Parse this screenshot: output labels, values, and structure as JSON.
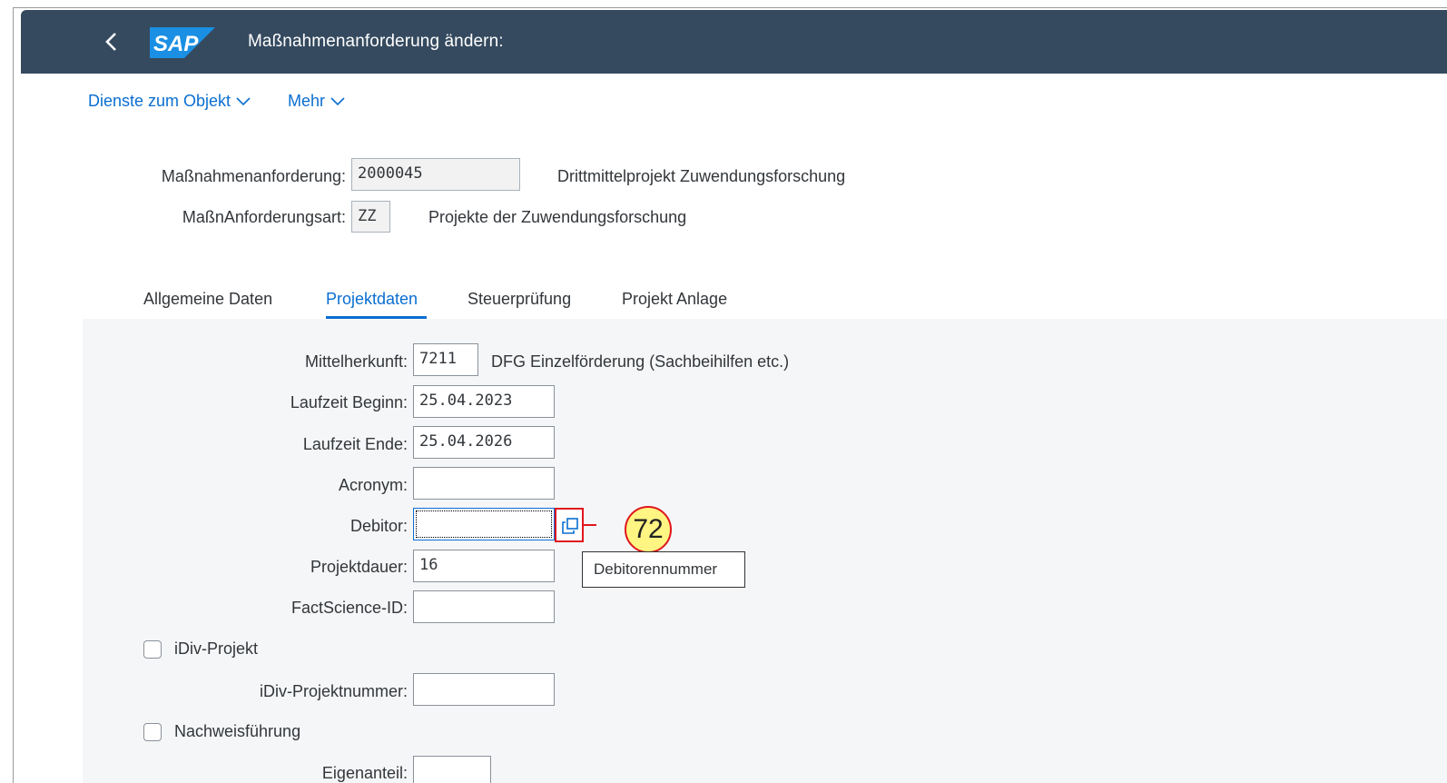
{
  "header": {
    "back_label": "<",
    "logo_text": "SAP",
    "title": "Maßnahmenanforderung ändern:"
  },
  "toolbar": {
    "services_label": "Dienste zum Objekt",
    "more_label": "Mehr"
  },
  "header_fields": {
    "request_label": "Maßnahmenanforderung:",
    "request_value": "2000045",
    "request_desc": "Drittmittelprojekt Zuwendungsforschung",
    "type_label": "MaßnAnforderungsart:",
    "type_value": "ZZ",
    "type_desc": "Projekte der Zuwendungsforschung"
  },
  "tabs": [
    {
      "label": "Allgemeine Daten",
      "active": false
    },
    {
      "label": "Projektdaten",
      "active": true
    },
    {
      "label": "Steuerprüfung",
      "active": false
    },
    {
      "label": "Projekt Anlage",
      "active": false
    }
  ],
  "form": {
    "fund_source_label": "Mittelherkunft:",
    "fund_source_value": "7211",
    "fund_source_desc": "DFG Einzelförderung (Sachbeihilfen etc.)",
    "start_label": "Laufzeit Beginn:",
    "start_value": "25.04.2023",
    "end_label": "Laufzeit Ende:",
    "end_value": "25.04.2026",
    "acronym_label": "Acronym:",
    "acronym_value": "",
    "debitor_label": "Debitor:",
    "debitor_value": "",
    "duration_label": "Projektdauer:",
    "duration_value": "16",
    "factscience_label": "FactScience-ID:",
    "factscience_value": "",
    "idiv_checkbox_label": "iDiv-Projekt",
    "idiv_checked": false,
    "idiv_number_label": "iDiv-Projektnummer:",
    "idiv_number_value": "",
    "proof_checkbox_label": "Nachweisführung",
    "proof_checked": false,
    "own_share_label": "Eigenanteil:"
  },
  "annotation": {
    "step_number": "72",
    "tooltip_text": "Debitorennummer",
    "highlight_color": "#e0161d",
    "callout_fill": "#fff582"
  },
  "colors": {
    "shellbar": "#354a5f",
    "accent": "#0a6ed1",
    "panel": "#f5f6f7"
  }
}
